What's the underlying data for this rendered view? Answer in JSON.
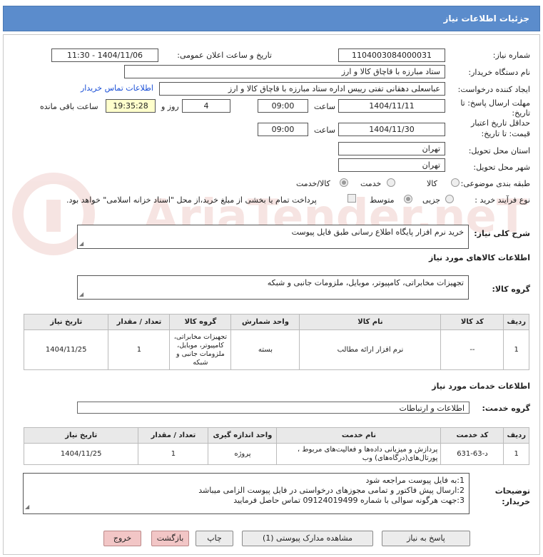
{
  "window": {
    "title": "جزئیات اطلاعات نیاز"
  },
  "fields": {
    "need_number_label": "شماره نیاز:",
    "need_number": "1104003084000031",
    "announce_label": "تاریخ و ساعت اعلان عمومی:",
    "announce_value": "1404/11/06 - 11:30",
    "buyer_label": "نام دستگاه خریدار:",
    "buyer_value": "ستاد مبارزه با قاچاق کالا و ارز",
    "creator_label": "ایجاد کننده درخواست:",
    "creator_value": "عباسعلی  دهقانی تفتی رییس اداره ستاد مبارزه با قاچاق کالا و ارز",
    "contact_link": "اطلاعات تماس خریدار",
    "deadline_label": "مهلت ارسال پاسخ: تا تاریخ:",
    "deadline_date": "1404/11/11",
    "time_label": "ساعت",
    "deadline_time": "09:00",
    "days_value": "4",
    "days_label": "روز و",
    "remaining_time": "19:35:28",
    "remaining_label": "ساعت باقی مانده",
    "validity_label_1": "حداقل تاریخ اعتبار",
    "validity_label_2": "قیمت: تا تاریخ:",
    "validity_date": "1404/11/30",
    "validity_time": "09:00",
    "province_label": "استان محل تحویل:",
    "province_value": "تهران",
    "city_label": "شهر محل تحویل:",
    "city_value": "تهران",
    "category_label": "طبقه بندی موضوعی:",
    "category_options": [
      "کالا",
      "خدمت",
      "کالا/خدمت"
    ],
    "purchase_label": "نوع فرآیند خرید :",
    "purchase_options": [
      "جزیی",
      "متوسط"
    ],
    "payment_note": "پرداخت تمام یا بخشی از مبلغ خرید،از محل \"اسناد خزانه اسلامی\" خواهد بود."
  },
  "summary": {
    "label": "شرح کلی نیاز:",
    "value": "خرید نرم افزار پایگاه اطلاع رسانی طبق فایل  پیوست"
  },
  "goods": {
    "section_title": "اطلاعات کالاهای مورد نیاز",
    "group_label": "گروه کالا:",
    "group_value": "تجهیزات مخابراتی، کامپیوتر، موبایل، ملزومات جانبی و شبکه",
    "headers": [
      "ردیف",
      "کد کالا",
      "نام کالا",
      "واحد شمارش",
      "گروه کالا",
      "تعداد / مقدار",
      "تاریخ نیاز"
    ],
    "rows": [
      {
        "row": "1",
        "code": "--",
        "name": "نرم افزار ارائه مطالب",
        "unit": "بسته",
        "group": "تجهیزات مخابراتی، کامپیوتر، موبایل، ملزومات جانبی و شبکه",
        "qty": "1",
        "date": "1404/11/25"
      }
    ]
  },
  "services": {
    "section_title": "اطلاعات خدمات مورد نیاز",
    "group_label": "گروه خدمت:",
    "group_value": "اطلاعات و ارتباطات",
    "headers": [
      "ردیف",
      "کد خدمت",
      "نام خدمت",
      "واحد اندازه گیری",
      "تعداد / مقدار",
      "تاریخ نیاز"
    ],
    "rows": [
      {
        "row": "1",
        "code": "د-63-631",
        "name": "پردازش و میزبانی داده‌ها و فعالیت‌های مربوط ، پورتال‌های(درگاه‌های) وب",
        "unit": "پروژه",
        "qty": "1",
        "date": "1404/11/25"
      }
    ]
  },
  "notes": {
    "label_1": "توضیحات",
    "label_2": "خریدار:",
    "lines": [
      "1:به فایل پیوست مراجعه شود",
      "2:ارسال پیش فاکتور و تمامی مجوزهای درخواستی در فایل پیوست الزامی میباشد",
      "3:جهت هرگونه سوالی با شماره 09124019499 تماس حاصل فرمایید"
    ]
  },
  "buttons": {
    "reply": "پاسخ به نیاز",
    "attachments": "مشاهده مدارک پیوستی (1)",
    "print": "چاپ",
    "back": "بازگشت",
    "exit": "خروج"
  },
  "watermark": "AriaTender.neT",
  "colors": {
    "header_bg": "#5b8ccc",
    "link": "#1a4fd6",
    "highlight": "#ffffcc"
  }
}
